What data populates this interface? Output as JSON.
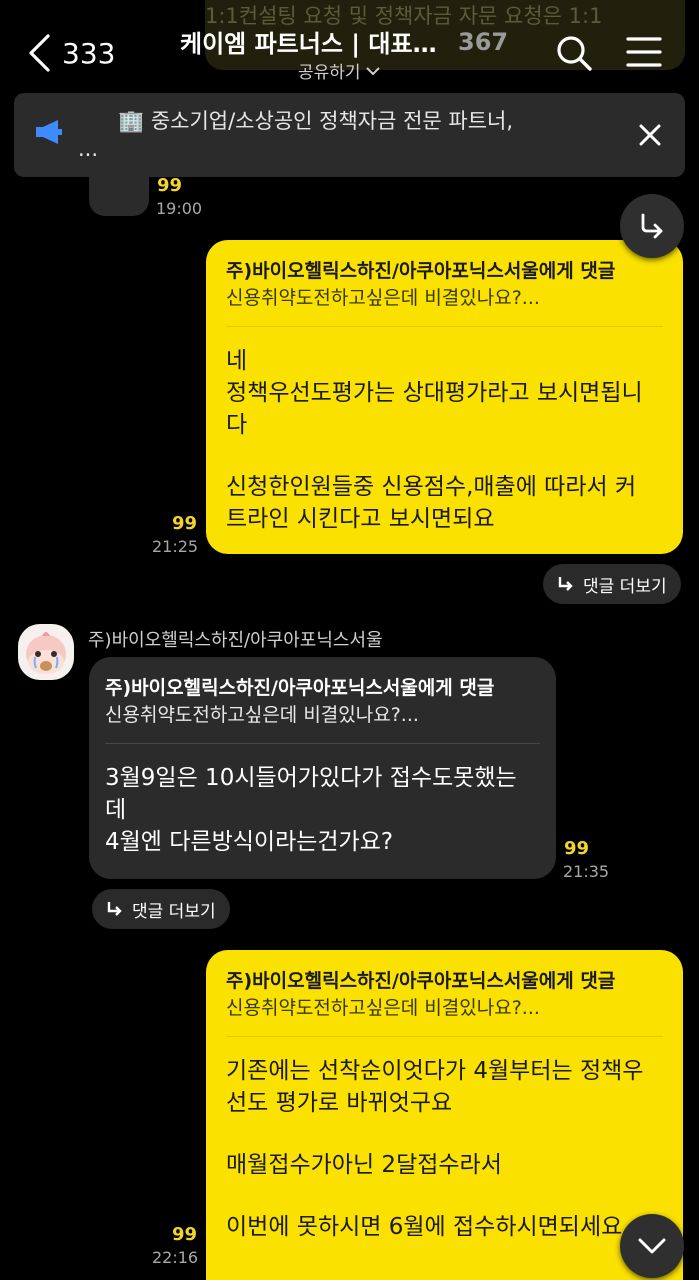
{
  "header": {
    "back_count": "333",
    "title": "케이엠 파트너스 | 대표...",
    "member_count": "367",
    "share_label": "공유하기",
    "ghost_text": "1:1컨설팅 요청 및 정책자금 자문 요청은 1:1"
  },
  "notice": {
    "text": "🏢 중소기업/소상공인 정책자금 전문 파트너,",
    "more": "..."
  },
  "messages": {
    "partial": {
      "read": "99",
      "time": "19:00"
    },
    "m1": {
      "reply_to": "주)바이오헬릭스하진/아쿠아포닉스서울에게 댓글",
      "quote": "신용취약도전하고싶은데 비결있나요?...",
      "lines": [
        "네",
        "정책우선도평가는 상대평가라고 보시면됩니",
        "다",
        "신청한인원들중 신용점수,매출에 따라서 커",
        "트라인 시킨다고 보시면되요"
      ],
      "read": "99",
      "time": "21:25",
      "thread": "댓글 더보기"
    },
    "m2": {
      "sender": "주)바이오헬릭스하진/아쿠아포닉스서울",
      "reply_to": "주)바이오헬릭스하진/아쿠아포닉스서울에게 댓글",
      "quote": "신용취약도전하고싶은데 비결있나요?...",
      "lines": [
        "3월9일은 10시들어가있다가 접수도못했는",
        "데",
        "4월엔 다른방식이라는건가요?"
      ],
      "read": "99",
      "time": "21:35",
      "thread": "댓글 더보기"
    },
    "m3": {
      "reply_to": "주)바이오헬릭스하진/아쿠아포닉스서울에게 댓글",
      "quote": "신용취약도전하고싶은데 비결있나요?...",
      "lines": [
        "기존에는 선착순이엇다가 4월부터는 정책우",
        "선도 평가로 바뀌엇구요",
        "매월접수가아닌 2달접수라서",
        "이번에 못하시면 6월에 접수하시면되세요"
      ],
      "read": "99",
      "time": "22:16"
    }
  },
  "colors": {
    "my_bubble": "#fae100",
    "other_bubble": "#2b2b2b",
    "read_count": "#f4d52a"
  }
}
